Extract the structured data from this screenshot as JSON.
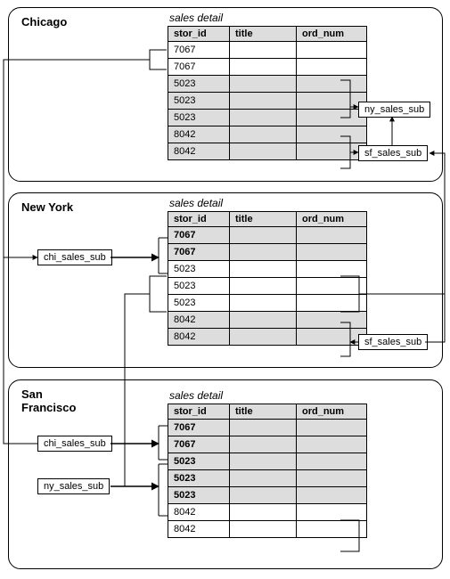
{
  "panels": {
    "chicago": {
      "title": "Chicago",
      "caption": "sales detail"
    },
    "newyork": {
      "title": "New York",
      "caption": "sales detail"
    },
    "sanfrancisco": {
      "title": "San\nFrancisco",
      "caption": "sales detail"
    }
  },
  "columns": {
    "stor_id": "stor_id",
    "title": "title",
    "ord_num": "ord_num"
  },
  "tables": {
    "chicago": {
      "rows": [
        {
          "stor_id": "7067",
          "title": "",
          "ord_num": "",
          "sub": false,
          "bold": false
        },
        {
          "stor_id": "7067",
          "title": "",
          "ord_num": "",
          "sub": false,
          "bold": false
        },
        {
          "stor_id": "5023",
          "title": "",
          "ord_num": "",
          "sub": true,
          "bold": false
        },
        {
          "stor_id": "5023",
          "title": "",
          "ord_num": "",
          "sub": true,
          "bold": false
        },
        {
          "stor_id": "5023",
          "title": "",
          "ord_num": "",
          "sub": true,
          "bold": false
        },
        {
          "stor_id": "8042",
          "title": "",
          "ord_num": "",
          "sub": true,
          "bold": false
        },
        {
          "stor_id": "8042",
          "title": "",
          "ord_num": "",
          "sub": true,
          "bold": false
        }
      ]
    },
    "newyork": {
      "rows": [
        {
          "stor_id": "7067",
          "title": "",
          "ord_num": "",
          "sub": true,
          "bold": true
        },
        {
          "stor_id": "7067",
          "title": "",
          "ord_num": "",
          "sub": true,
          "bold": true
        },
        {
          "stor_id": "5023",
          "title": "",
          "ord_num": "",
          "sub": false,
          "bold": false
        },
        {
          "stor_id": "5023",
          "title": "",
          "ord_num": "",
          "sub": false,
          "bold": false
        },
        {
          "stor_id": "5023",
          "title": "",
          "ord_num": "",
          "sub": false,
          "bold": false
        },
        {
          "stor_id": "8042",
          "title": "",
          "ord_num": "",
          "sub": true,
          "bold": false
        },
        {
          "stor_id": "8042",
          "title": "",
          "ord_num": "",
          "sub": true,
          "bold": false
        }
      ]
    },
    "sanfrancisco": {
      "rows": [
        {
          "stor_id": "7067",
          "title": "",
          "ord_num": "",
          "sub": true,
          "bold": true
        },
        {
          "stor_id": "7067",
          "title": "",
          "ord_num": "",
          "sub": true,
          "bold": true
        },
        {
          "stor_id": "5023",
          "title": "",
          "ord_num": "",
          "sub": true,
          "bold": true
        },
        {
          "stor_id": "5023",
          "title": "",
          "ord_num": "",
          "sub": true,
          "bold": true
        },
        {
          "stor_id": "5023",
          "title": "",
          "ord_num": "",
          "sub": true,
          "bold": true
        },
        {
          "stor_id": "8042",
          "title": "",
          "ord_num": "",
          "sub": false,
          "bold": false
        },
        {
          "stor_id": "8042",
          "title": "",
          "ord_num": "",
          "sub": false,
          "bold": false
        }
      ]
    }
  },
  "labels": {
    "chi_sales_sub": "chi_sales_sub",
    "ny_sales_sub": "ny_sales_sub",
    "sf_sales_sub": "sf_sales_sub"
  }
}
